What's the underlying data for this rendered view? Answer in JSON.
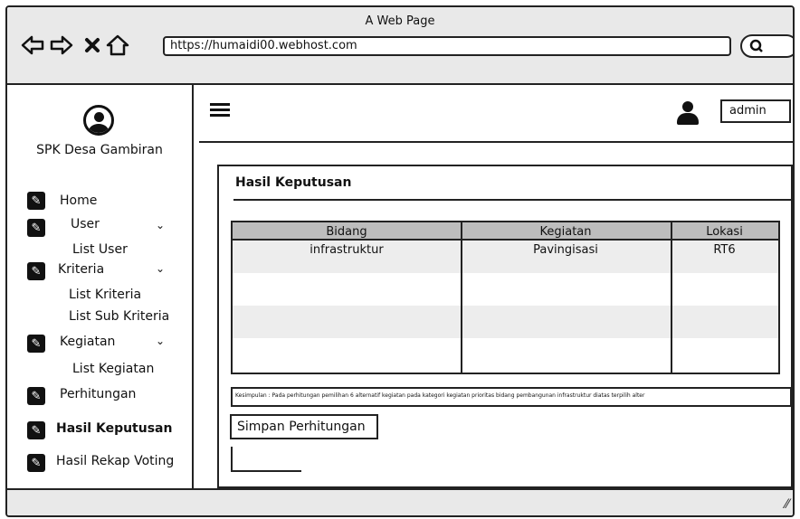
{
  "window": {
    "title": "A Web Page"
  },
  "browser": {
    "url": "https://humaidi00.webhost.com",
    "back_icon": "arrow-left-icon",
    "forward_icon": "arrow-right-icon",
    "close_icon": "close-icon",
    "home_icon": "home-icon",
    "search_icon": "search-icon"
  },
  "sidebar": {
    "app_title": "SPK Desa Gambiran",
    "items": [
      {
        "label": "Home",
        "icon": "edit-icon"
      },
      {
        "label": "User",
        "icon": "edit-icon",
        "expandable": true
      },
      {
        "label": "List User"
      },
      {
        "label": "Kriteria",
        "icon": "edit-icon",
        "expandable": true
      },
      {
        "label": "List Kriteria"
      },
      {
        "label": "List Sub Kriteria"
      },
      {
        "label": "Kegiatan",
        "icon": "edit-icon",
        "expandable": true
      },
      {
        "label": "List Kegiatan"
      },
      {
        "label": "Perhitungan",
        "icon": "edit-icon"
      },
      {
        "label": "Hasil Keputusan",
        "icon": "edit-icon",
        "active": true
      },
      {
        "label": "Hasil Rekap Voting",
        "icon": "edit-icon"
      }
    ]
  },
  "header": {
    "user": "admin",
    "menu_icon": "hamburger-icon",
    "user_icon": "user-icon"
  },
  "main": {
    "card_title": "Hasil Keputusan",
    "table": {
      "columns": [
        "Bidang",
        "Kegiatan",
        "Lokasi"
      ],
      "rows": [
        [
          "infrastruktur",
          "Pavingisasi",
          "RT6"
        ]
      ]
    },
    "conclusion": "Kesimpulan : Pada perhitungan pemilihan 6 alternatif kegiatan pada kategori kegiatan prioritas bidang pembangunan infrastruktur diatas terpilih alter",
    "save_button": "Simpan Perhitungan"
  },
  "colors": {
    "chrome": "#e9e9e9",
    "table_header": "#bdbdbd",
    "table_stripe": "#ededed",
    "ink": "#111111"
  }
}
